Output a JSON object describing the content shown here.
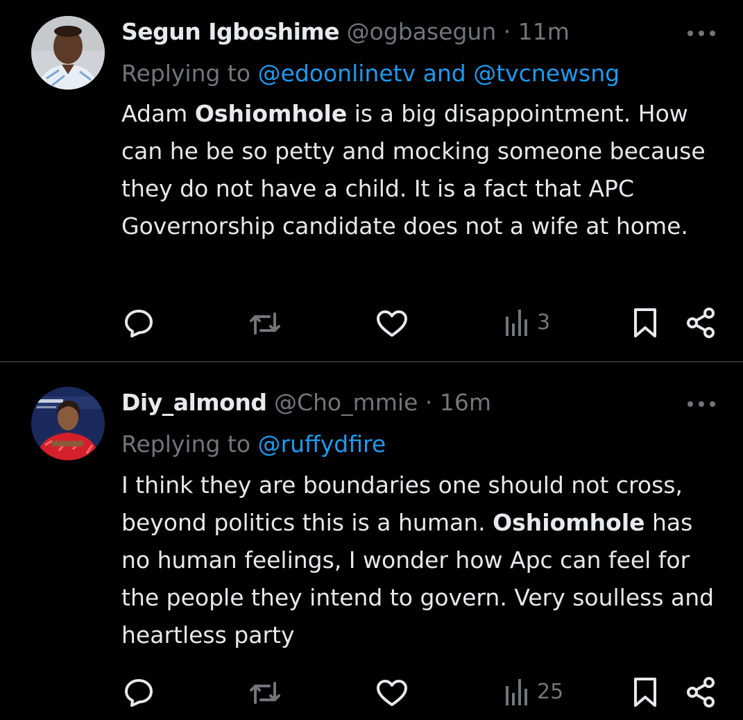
{
  "tweets": [
    {
      "name": "Segun Igboshime",
      "handle": "@ogbasegun",
      "sep": "·",
      "time": "11m",
      "replying_prefix": "Replying to",
      "replying_mentions": [
        {
          "text": "@edoonlinetv"
        },
        {
          "text": "@tvcnewsng"
        }
      ],
      "replying_joiner": "and",
      "body_parts": [
        "Adam ",
        "Oshiomhole",
        " is a big disappointment. How can he be so petty and mocking someone because they do not have a child. It is a fact that APC Governorship candidate does not a wife at home."
      ],
      "views": "3",
      "avatar_colors": {
        "bg": "#cfd2d6",
        "skin": "#5b3a27",
        "shirt": "#e8eef4"
      }
    },
    {
      "name": "Diy_almond",
      "handle": "@Cho_mmie",
      "sep": "·",
      "time": "16m",
      "replying_prefix": "Replying to",
      "replying_mentions": [
        {
          "text": "@ruffydfire"
        }
      ],
      "body_parts": [
        "I think they are boundaries one should not cross, beyond politics this is a human. ",
        "Oshiomhole",
        " has no human feelings, I wonder how Apc can feel for the people they intend to govern. Very soulless and heartless party"
      ],
      "views": "25",
      "avatar_colors": {
        "bg": "#1b2a5c",
        "dress": "#d4202a",
        "skin": "#8a5a3c"
      }
    }
  ],
  "colors": {
    "background": "#000000",
    "text": "#e7e9ea",
    "muted": "#71767b",
    "link": "#1d9bf0",
    "divider": "#2f3336"
  },
  "icons": [
    "reply-icon",
    "retweet-icon",
    "like-icon",
    "views-icon",
    "bookmark-icon",
    "share-icon",
    "more-icon"
  ]
}
